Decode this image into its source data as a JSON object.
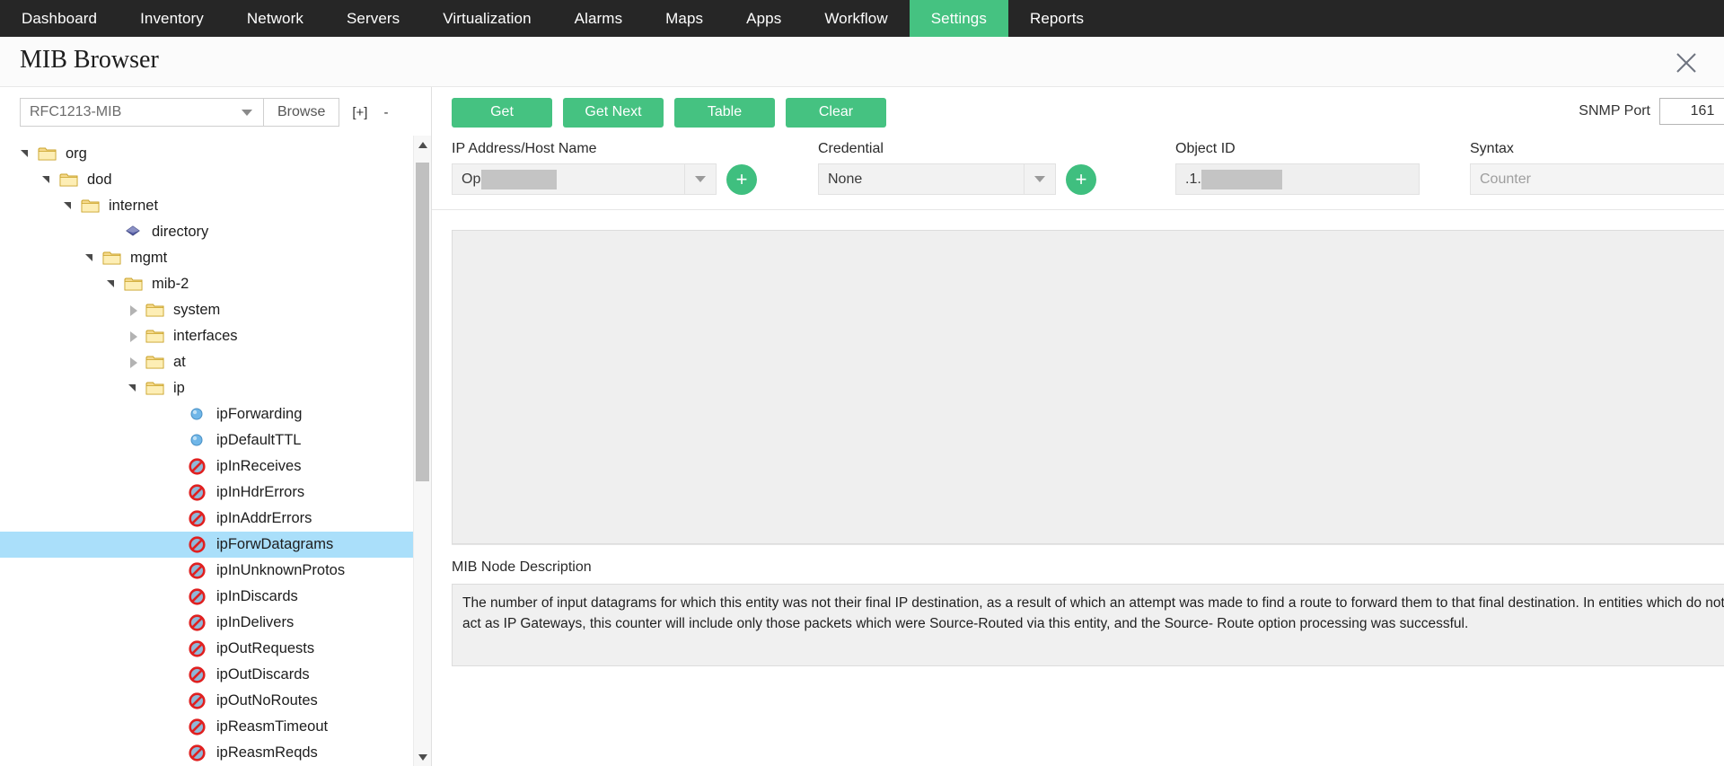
{
  "topnav": {
    "items": [
      {
        "label": "Dashboard",
        "active": false
      },
      {
        "label": "Inventory",
        "active": false
      },
      {
        "label": "Network",
        "active": false
      },
      {
        "label": "Servers",
        "active": false
      },
      {
        "label": "Virtualization",
        "active": false
      },
      {
        "label": "Alarms",
        "active": false
      },
      {
        "label": "Maps",
        "active": false
      },
      {
        "label": "Apps",
        "active": false
      },
      {
        "label": "Workflow",
        "active": false
      },
      {
        "label": "Settings",
        "active": true
      },
      {
        "label": "Reports",
        "active": false
      }
    ],
    "active_color": "#45c281",
    "bg_color": "#262626"
  },
  "header": {
    "title": "MIB Browser",
    "close_icon": "close-icon"
  },
  "mib_selector": {
    "selected_mib": "RFC1213-MIB",
    "dropdown_icon": "chevron-down-icon",
    "browse_label": "Browse",
    "expand_all_label": "[+]",
    "collapse_all_label": "-"
  },
  "tree": {
    "nodes": [
      {
        "label": "org",
        "depth": 0,
        "icon": "folder-icon",
        "twisty": "open",
        "selected": false
      },
      {
        "label": "dod",
        "depth": 1,
        "icon": "folder-icon",
        "twisty": "open",
        "selected": false
      },
      {
        "label": "internet",
        "depth": 2,
        "icon": "folder-icon",
        "twisty": "open",
        "selected": false
      },
      {
        "label": "directory",
        "depth": 4,
        "icon": "diamond-icon",
        "twisty": "none",
        "selected": false
      },
      {
        "label": "mgmt",
        "depth": 3,
        "icon": "folder-icon",
        "twisty": "open",
        "selected": false
      },
      {
        "label": "mib-2",
        "depth": 4,
        "icon": "folder-icon",
        "twisty": "open",
        "selected": false
      },
      {
        "label": "system",
        "depth": 5,
        "icon": "folder-icon",
        "twisty": "closed",
        "selected": false
      },
      {
        "label": "interfaces",
        "depth": 5,
        "icon": "folder-icon",
        "twisty": "closed",
        "selected": false
      },
      {
        "label": "at",
        "depth": 5,
        "icon": "folder-icon",
        "twisty": "closed",
        "selected": false
      },
      {
        "label": "ip",
        "depth": 5,
        "icon": "folder-icon",
        "twisty": "open",
        "selected": false
      },
      {
        "label": "ipForwarding",
        "depth": 7,
        "icon": "blue-sphere-icon",
        "twisty": "none",
        "selected": false
      },
      {
        "label": "ipDefaultTTL",
        "depth": 7,
        "icon": "blue-sphere-icon",
        "twisty": "none",
        "selected": false
      },
      {
        "label": "ipInReceives",
        "depth": 7,
        "icon": "no-entry-icon",
        "twisty": "none",
        "selected": false
      },
      {
        "label": "ipInHdrErrors",
        "depth": 7,
        "icon": "no-entry-icon",
        "twisty": "none",
        "selected": false
      },
      {
        "label": "ipInAddrErrors",
        "depth": 7,
        "icon": "no-entry-icon",
        "twisty": "none",
        "selected": false
      },
      {
        "label": "ipForwDatagrams",
        "depth": 7,
        "icon": "no-entry-icon",
        "twisty": "none",
        "selected": true
      },
      {
        "label": "ipInUnknownProtos",
        "depth": 7,
        "icon": "no-entry-icon",
        "twisty": "none",
        "selected": false
      },
      {
        "label": "ipInDiscards",
        "depth": 7,
        "icon": "no-entry-icon",
        "twisty": "none",
        "selected": false
      },
      {
        "label": "ipInDelivers",
        "depth": 7,
        "icon": "no-entry-icon",
        "twisty": "none",
        "selected": false
      },
      {
        "label": "ipOutRequests",
        "depth": 7,
        "icon": "no-entry-icon",
        "twisty": "none",
        "selected": false
      },
      {
        "label": "ipOutDiscards",
        "depth": 7,
        "icon": "no-entry-icon",
        "twisty": "none",
        "selected": false
      },
      {
        "label": "ipOutNoRoutes",
        "depth": 7,
        "icon": "no-entry-icon",
        "twisty": "none",
        "selected": false
      },
      {
        "label": "ipReasmTimeout",
        "depth": 7,
        "icon": "no-entry-icon",
        "twisty": "none",
        "selected": false
      },
      {
        "label": "ipReasmReqds",
        "depth": 7,
        "icon": "no-entry-icon",
        "twisty": "none",
        "selected": false
      }
    ],
    "selected_highlight_color": "#aadffa"
  },
  "toolbar": {
    "buttons": [
      {
        "label": "Get"
      },
      {
        "label": "Get Next"
      },
      {
        "label": "Table"
      },
      {
        "label": "Clear"
      }
    ],
    "button_color": "#45c281"
  },
  "snmp_port": {
    "label": "SNMP Port",
    "value": "161"
  },
  "form": {
    "ip_address": {
      "label": "IP Address/Host Name",
      "value": "Op",
      "redacted": true,
      "dropdown_icon": "chevron-down-icon",
      "add_label": "+"
    },
    "credential": {
      "label": "Credential",
      "value": "None",
      "dropdown_icon": "chevron-down-icon",
      "add_label": "+"
    },
    "object_id": {
      "label": "Object ID",
      "value": ".1.",
      "redacted": true
    },
    "syntax": {
      "label": "Syntax",
      "placeholder": "Counter",
      "value": ""
    }
  },
  "description": {
    "label": "MIB Node Description",
    "text": "The number of input datagrams for which this entity was not their final IP destination, as a result of which an attempt was made to find a route to forward them to that final destination. In entities which do not act as IP Gateways, this counter will include only those packets which were Source-Routed via this entity, and the Source- Route option processing was successful."
  },
  "scrollbar": {
    "up_icon": "caret-up-icon",
    "down_icon": "caret-down-icon"
  }
}
